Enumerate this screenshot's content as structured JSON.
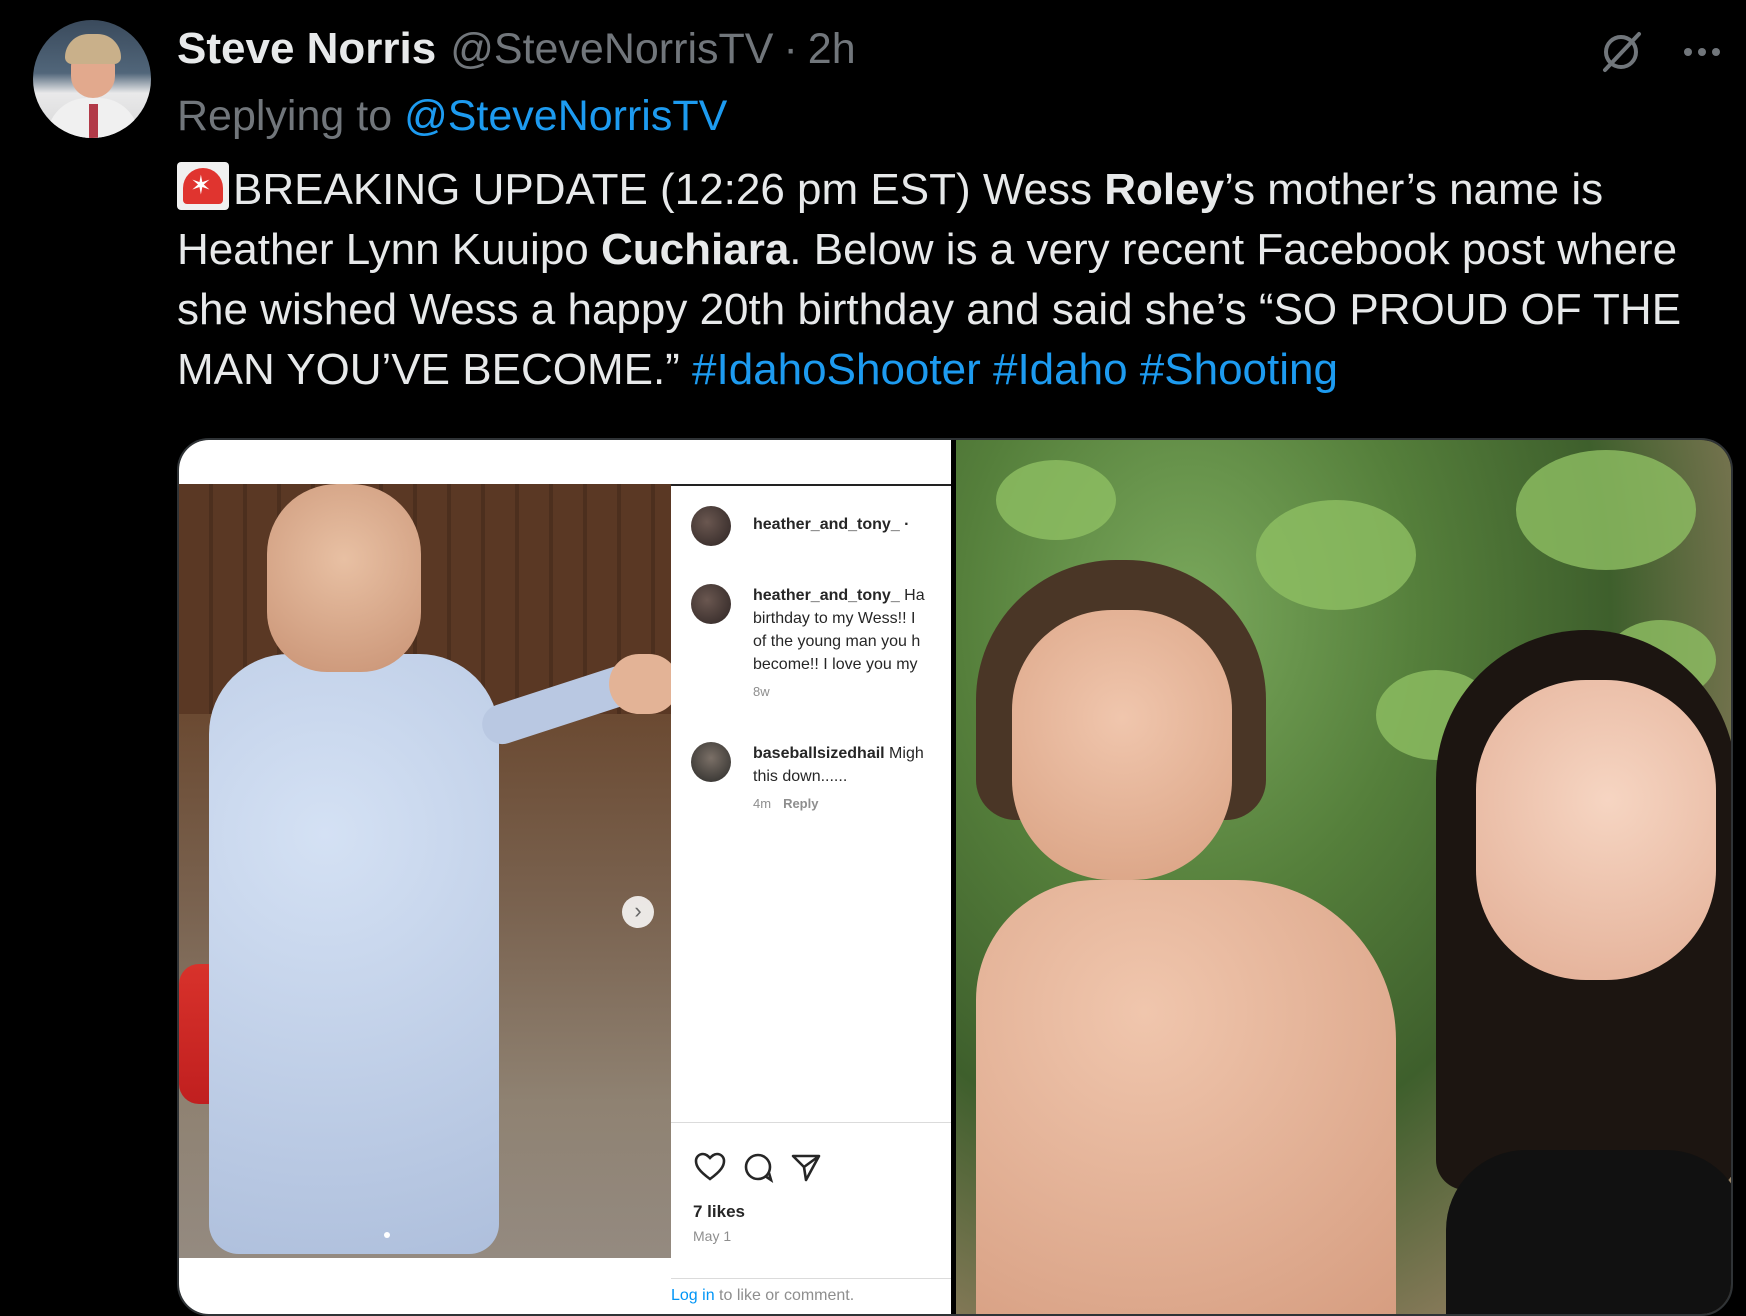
{
  "author": {
    "name": "Steve Norris",
    "handle": "@SteveNorrisTV",
    "separator": "·",
    "time": "2h"
  },
  "replying": {
    "prefix": "Replying to",
    "mention": "@SteveNorrisTV"
  },
  "tweet": {
    "part1": "BREAKING UPDATE (12:26 pm EST) Wess ",
    "bold1": "Roley",
    "part2": "’s mother’s name is Heather Lynn Kuuipo ",
    "bold2": "Cuchiara",
    "part3": ". Below is a very recent Facebook post where she wished Wess a happy 20th birthday and said she’s “SO PROUD OF THE MAN YOU’VE BECOME.” ",
    "hashtags": [
      "#IdahoShooter",
      "#Idaho",
      "#Shooting"
    ]
  },
  "instagram": {
    "header_user": "heather_and_tony_",
    "header_dot": "·",
    "comments": [
      {
        "user": "heather_and_tony_",
        "lines": [
          " Ha",
          "birthday to my Wess!! I",
          "of the young man you h",
          "become!! I love you my"
        ],
        "time": "8w",
        "reply": ""
      },
      {
        "user": "baseballsizedhail",
        "lines": [
          " Migh",
          "this down......"
        ],
        "time": "4m",
        "reply": "Reply"
      }
    ],
    "likes": "7 likes",
    "date": "May 1",
    "login_link": "Log in",
    "login_rest": " to like or comment."
  },
  "icons": {
    "siren": "police-siren-emoji",
    "options": "slashed-circle-icon",
    "more": "more-options-icon",
    "like": "heart-icon",
    "comment": "comment-bubble-icon",
    "share": "send-icon",
    "carousel_next": "chevron-right-icon"
  },
  "colors": {
    "background": "#000000",
    "text": "#e7e9ea",
    "muted": "#71767b",
    "link": "#1d9bf0"
  }
}
